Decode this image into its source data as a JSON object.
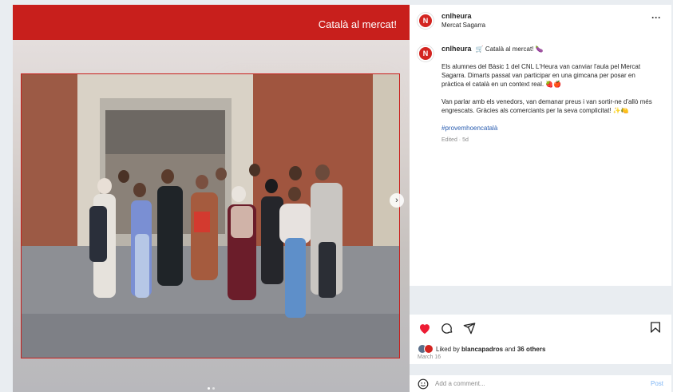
{
  "media": {
    "banner_title": "Català al mercat!",
    "carousel_next": "›"
  },
  "post": {
    "avatar_text": "N",
    "username": "cnlheura",
    "location": "Mercat Sagarra",
    "more": "···",
    "caption": {
      "title": "🛒 Català al mercat! 🍆",
      "paragraph1": "Els alumnes del Bàsic 1 del CNL L'Heura van canviar l'aula pel Mercat Sagarra. Dimarts passat van participar en una gimcana per posar en pràctica el català en un context real. 🍓🍎",
      "paragraph2": "Van parlar amb els venedors, van demanar preus i van sortir-ne d'allò més engrescats. Gràcies als comerciants per la seva complicitat! ✨🍋",
      "hashtag": "#provemhoencatalà",
      "edited": "Edited · 5d"
    },
    "likes": {
      "prefix": "Liked by ",
      "user": "blancapadros",
      "middle": " and ",
      "count": "36 others"
    },
    "date": "March 16",
    "comment": {
      "placeholder": "Add a comment...",
      "post_label": "Post"
    }
  },
  "colors": {
    "brand_red": "#c81f1c",
    "like_red": "#ed1c34",
    "link_blue": "#2a5db0"
  },
  "icons": [
    "heart-icon",
    "comment-icon",
    "share-icon",
    "bookmark-icon",
    "emoji-icon",
    "more-icon",
    "chevron-right-icon"
  ]
}
